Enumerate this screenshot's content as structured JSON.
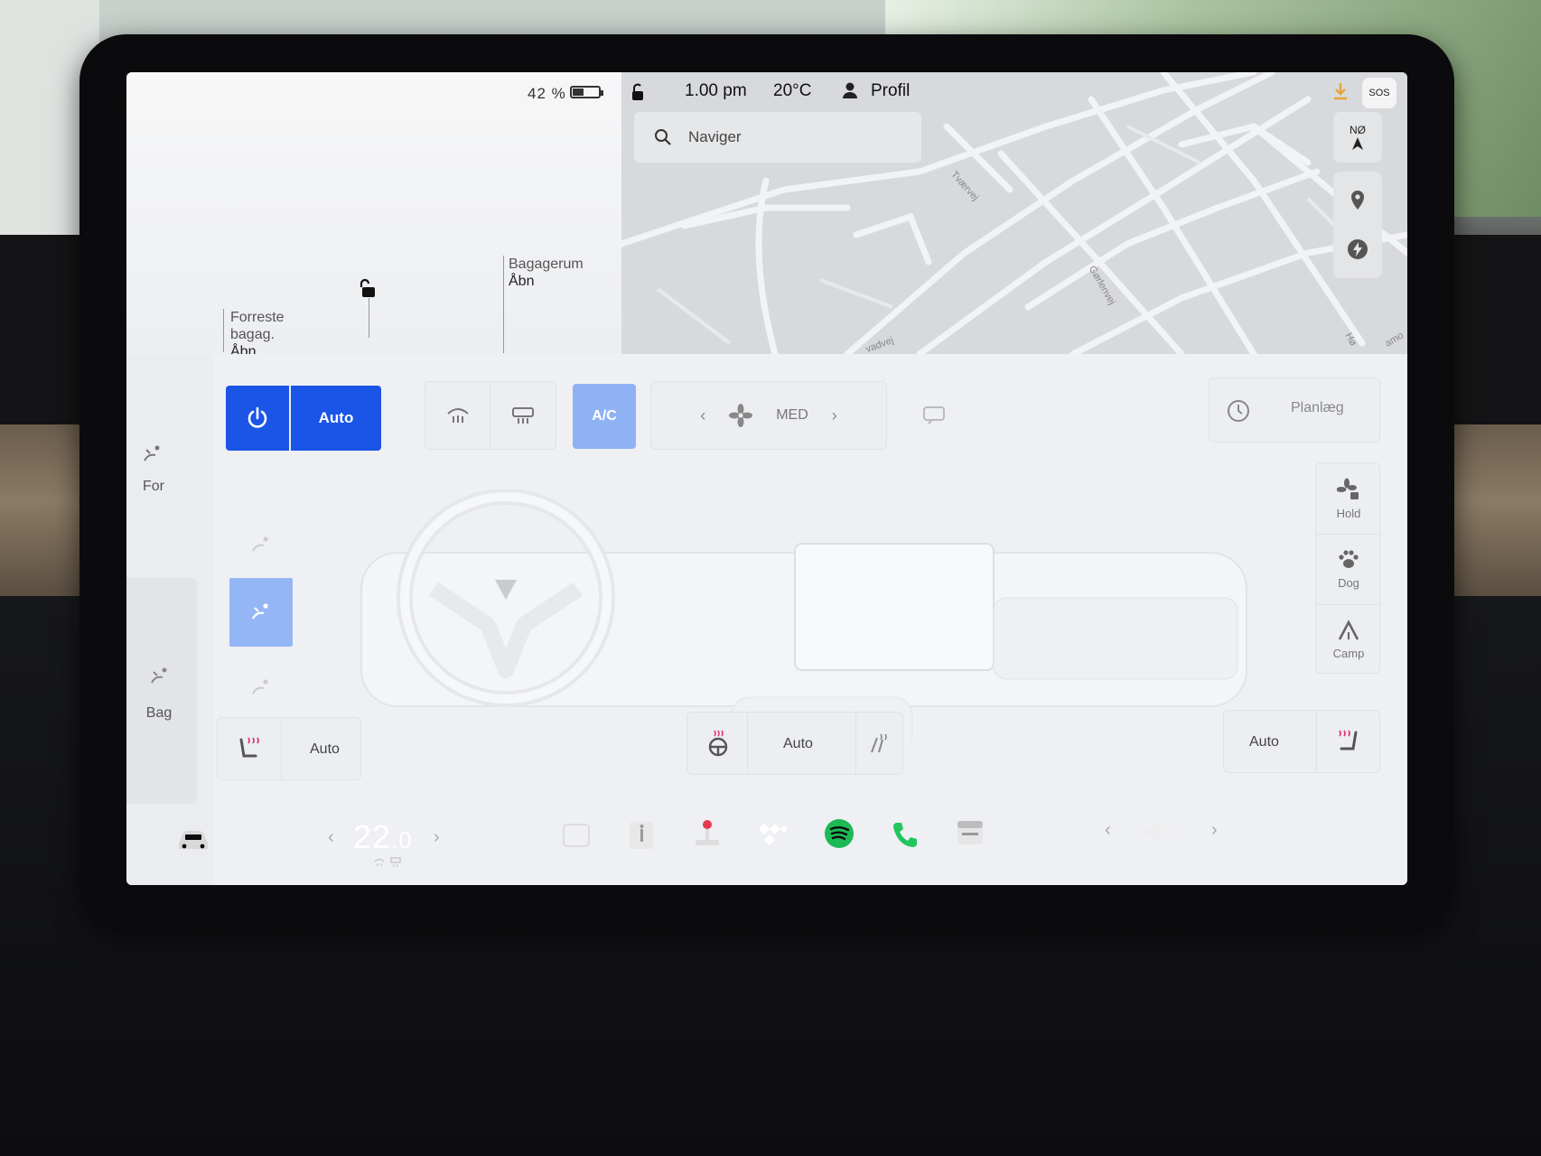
{
  "status": {
    "battery_percent": "42 %",
    "battery_level": 0.42,
    "time": "1.00 pm",
    "outside_temp": "20°C",
    "profile_label": "Profil"
  },
  "car_panel": {
    "front_trunk": {
      "line1": "Forreste",
      "line2": "bagag.",
      "action": "Åbn"
    },
    "rear_trunk": {
      "title": "Bagagerum",
      "action": "Åbn"
    }
  },
  "map": {
    "search_placeholder": "Naviger",
    "compass_heading": "NØ",
    "sos_label": "SOS",
    "street_labels": [
      "Tværvej",
      "Gørlenvej",
      "vadvej",
      "Hø",
      "amo"
    ]
  },
  "climate": {
    "auto_label": "Auto",
    "ac_label": "A/C",
    "fan_speed": "MED",
    "schedule_label": "Planlæg",
    "front_label": "For",
    "rear_label": "Bag",
    "modes": [
      {
        "label": "Hold",
        "icon": "fan-lock-icon"
      },
      {
        "label": "Dog",
        "icon": "paw-icon"
      },
      {
        "label": "Camp",
        "icon": "tent-icon"
      }
    ],
    "seat_driver_label": "Auto",
    "steering_label": "Auto",
    "seat_passenger_label": "Auto"
  },
  "dock": {
    "temperature": "22",
    "temperature_decimal": ".0",
    "apps": [
      "more-icon",
      "manual-icon",
      "toybox-icon",
      "tidal-icon",
      "spotify-icon",
      "phone-icon",
      "calendar-icon"
    ]
  },
  "colors": {
    "accent": "#1a55e8",
    "ac_active": "#8fb2f5",
    "spotify": "#1db954",
    "phone": "#22c55e",
    "heat": "#e0386b"
  }
}
